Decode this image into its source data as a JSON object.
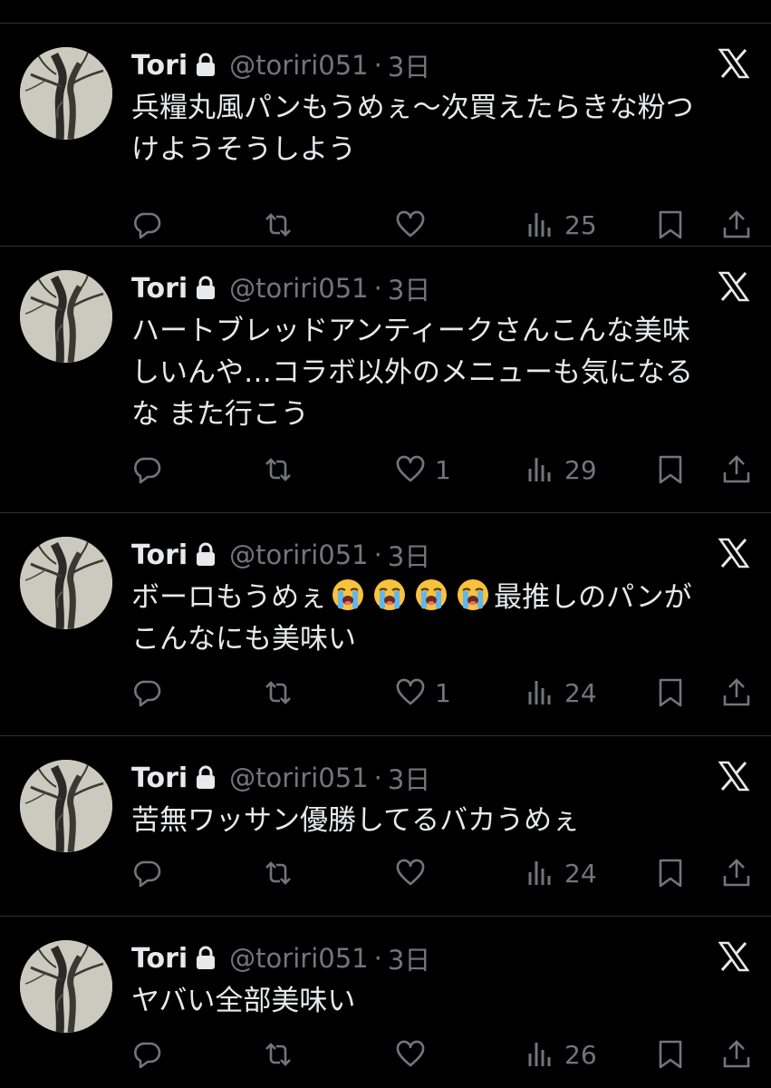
{
  "colors": {
    "background": "#000000",
    "text": "#e7e9ea",
    "muted": "#71767b",
    "divider": "#2f3336"
  },
  "icons": [
    "lock-icon",
    "x-logo-icon",
    "reply-icon",
    "repost-icon",
    "like-icon",
    "views-icon",
    "bookmark-icon",
    "share-icon",
    "loudly-crying-face-emoji"
  ],
  "tweets": [
    {
      "author": {
        "name": "Tori",
        "handle": "@toriri051",
        "time": "3日"
      },
      "text": [
        "兵糧丸風パンもうめぇ〜次買えたらきな粉つ",
        "けようそうしよう"
      ],
      "counts": {
        "likes": "",
        "views": "25"
      }
    },
    {
      "author": {
        "name": "Tori",
        "handle": "@toriri051",
        "time": "3日"
      },
      "text": [
        "ハートブレッドアンティークさんこんな美味",
        "しいんや…コラボ以外のメニューも気になる",
        "な また行こう"
      ],
      "counts": {
        "likes": "1",
        "views": "29"
      }
    },
    {
      "author": {
        "name": "Tori",
        "handle": "@toriri051",
        "time": "3日"
      },
      "text_prefix": "ボーロもうめぇ",
      "emoji_count": 4,
      "text_suffix": "最推しのパンが",
      "text": [
        "こんなにも美味い"
      ],
      "counts": {
        "likes": "1",
        "views": "24"
      }
    },
    {
      "author": {
        "name": "Tori",
        "handle": "@toriri051",
        "time": "3日"
      },
      "text": [
        "苦無ワッサン優勝してるバカうめぇ"
      ],
      "counts": {
        "likes": "",
        "views": "24"
      }
    },
    {
      "author": {
        "name": "Tori",
        "handle": "@toriri051",
        "time": "3日"
      },
      "text": [
        "ヤバい全部美味い"
      ],
      "counts": {
        "likes": "",
        "views": "26"
      }
    }
  ]
}
